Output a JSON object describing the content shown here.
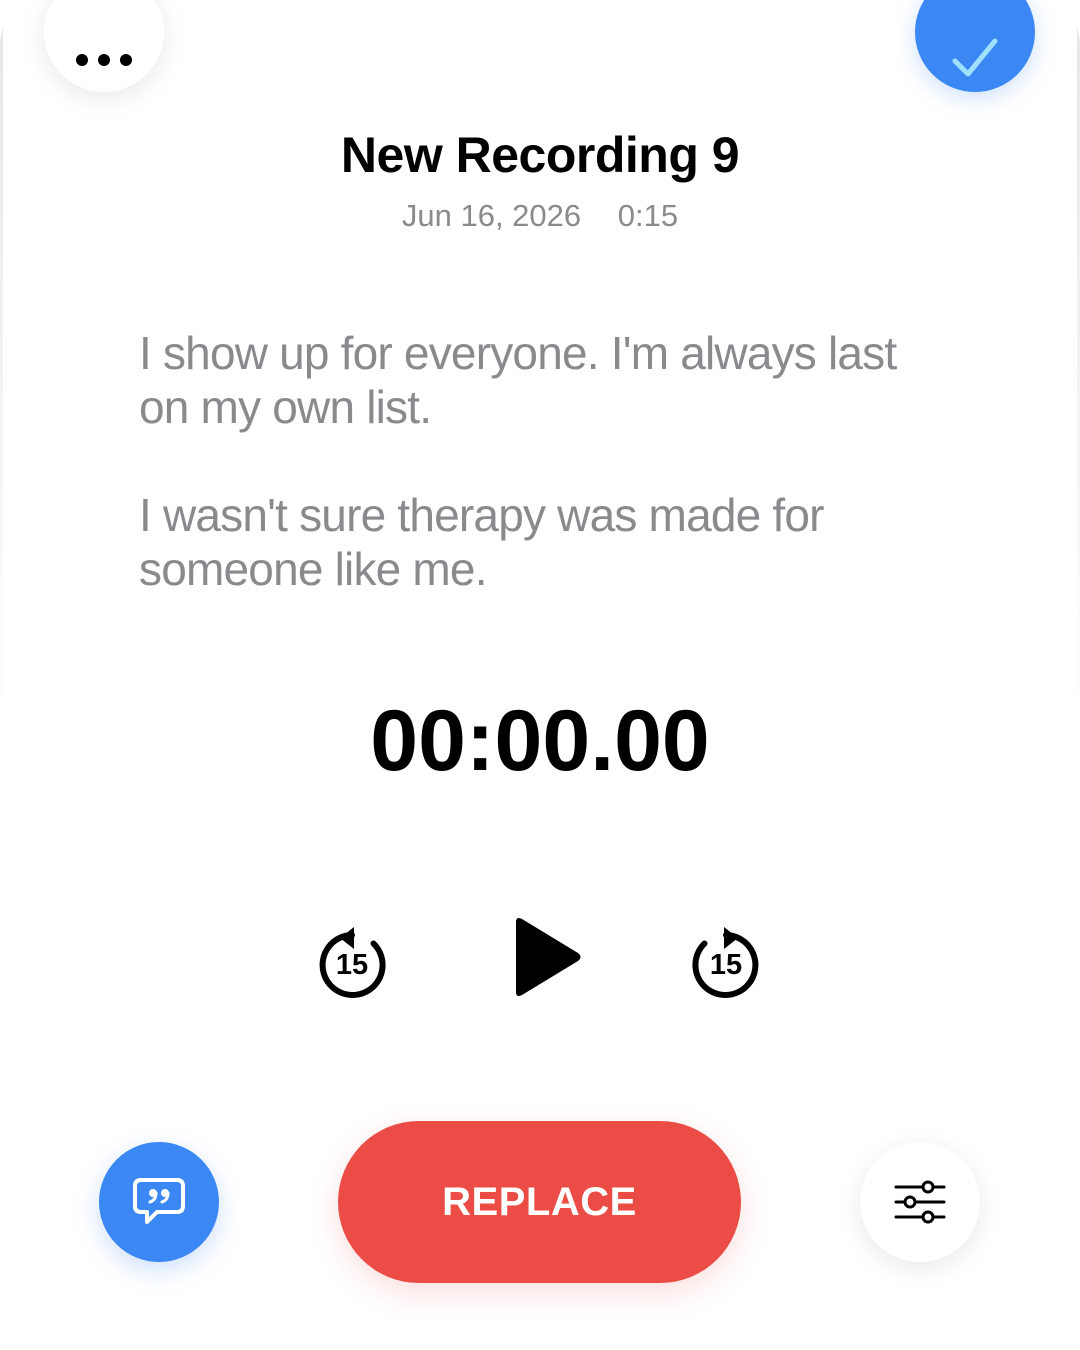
{
  "header": {
    "more_icon": "ellipsis-icon",
    "done_icon": "checkmark-icon"
  },
  "recording": {
    "title": "New Recording 9",
    "date": "Jun 16, 2026",
    "duration": "0:15"
  },
  "transcript": {
    "paragraphs": [
      "I show up for everyone. I'm always last on my own list.",
      "I wasn't sure therapy was made for someone like me."
    ]
  },
  "player": {
    "elapsed": "00:00.00",
    "skip_back_seconds": "15",
    "skip_forward_seconds": "15",
    "play_icon": "play-icon"
  },
  "footer": {
    "chat_icon": "quote-bubble-icon",
    "replace_label": "REPLACE",
    "settings_icon": "sliders-icon"
  },
  "colors": {
    "accent_blue": "#3b88f5",
    "replace_red": "#eb4c45",
    "secondary_text": "#8a8a8e"
  }
}
